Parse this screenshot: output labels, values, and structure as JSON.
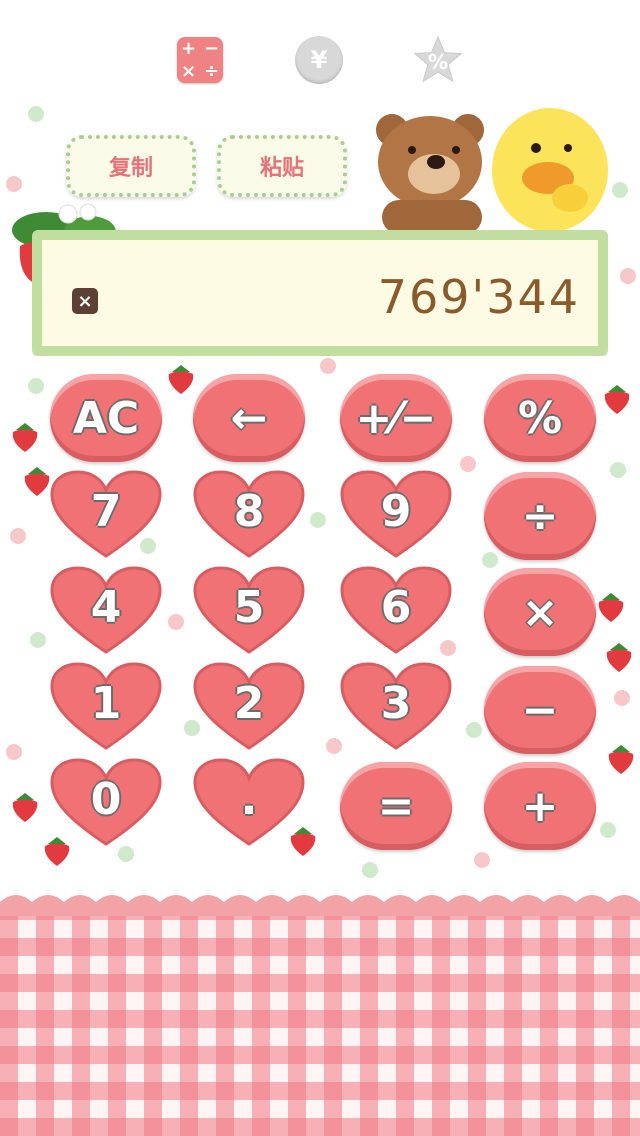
{
  "tabs": [
    {
      "name": "calculator",
      "label": "+ − × ÷",
      "active": true
    },
    {
      "name": "currency",
      "label": "¥"
    },
    {
      "name": "percent",
      "label": "%"
    }
  ],
  "actions": {
    "copy_label": "复制",
    "paste_label": "粘贴"
  },
  "display": {
    "value": "769'344",
    "clear_label": "×"
  },
  "keys": {
    "ac": "AC",
    "back": "←",
    "sign": "+⁄−",
    "percent": "%",
    "seven": "7",
    "eight": "8",
    "nine": "9",
    "divide": "÷",
    "four": "4",
    "five": "5",
    "six": "6",
    "multiply": "×",
    "one": "1",
    "two": "2",
    "three": "3",
    "minus": "−",
    "zero": "0",
    "dot": ".",
    "equals": "=",
    "plus": "+"
  },
  "colors": {
    "key": "#f07274",
    "accent_green": "#c1dd9f",
    "display_text": "#8b5a2b"
  }
}
